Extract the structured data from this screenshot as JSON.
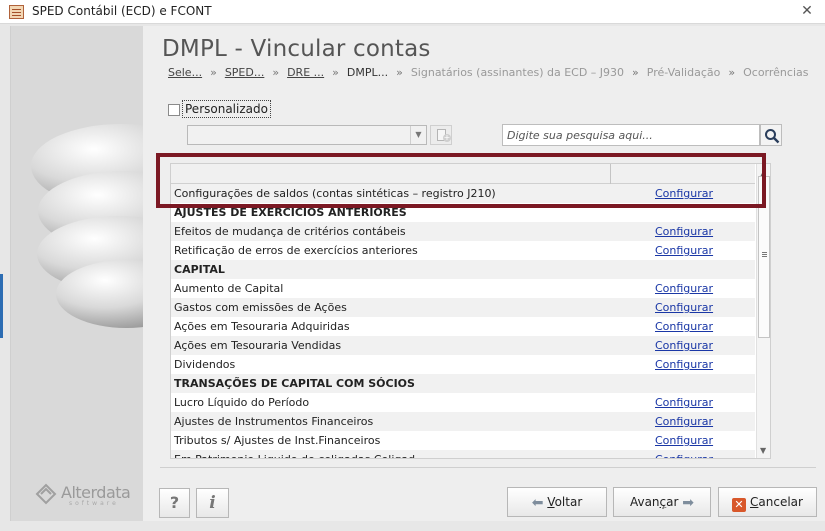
{
  "window": {
    "title": "SPED Contábil (ECD) e FCONT",
    "close_icon": "close-icon"
  },
  "page": {
    "title": "DMPL - Vincular contas"
  },
  "breadcrumb": [
    {
      "label": "Sele...",
      "state": "link"
    },
    {
      "label": "SPED...",
      "state": "link"
    },
    {
      "label": "DRE ...",
      "state": "link"
    },
    {
      "label": "DMPL...",
      "state": "current"
    },
    {
      "label": "Signatários (assinantes) da ECD – J930",
      "state": "muted"
    },
    {
      "label": "Pré-Validação",
      "state": "muted"
    },
    {
      "label": "Ocorrências",
      "state": "muted"
    }
  ],
  "breadcrumb_separator": "»",
  "filter": {
    "personalizado_label": "Personalizado",
    "personalizado_checked": false,
    "combo_value": "",
    "search_placeholder": "Digite sua pesquisa aqui..."
  },
  "grid": {
    "columns": [
      "",
      ""
    ],
    "rows": [
      {
        "label": "Configurações de saldos (contas sintéticas – registro J210)",
        "action": "Configurar",
        "group": false
      },
      {
        "label": "AJUSTES DE EXERCÍCIOS ANTERIORES",
        "action": "",
        "group": true
      },
      {
        "label": "Efeitos de mudança de critérios contábeis",
        "action": "Configurar",
        "group": false
      },
      {
        "label": "Retificação de erros de exercícios anteriores",
        "action": "Configurar",
        "group": false
      },
      {
        "label": "CAPITAL",
        "action": "",
        "group": true
      },
      {
        "label": "Aumento de Capital",
        "action": "Configurar",
        "group": false
      },
      {
        "label": "Gastos com emissões de Ações",
        "action": "Configurar",
        "group": false
      },
      {
        "label": "Ações em Tesouraria Adquiridas",
        "action": "Configurar",
        "group": false
      },
      {
        "label": "Ações em Tesouraria Vendidas",
        "action": "Configurar",
        "group": false
      },
      {
        "label": "Dividendos",
        "action": "Configurar",
        "group": false
      },
      {
        "label": "TRANSAÇÕES DE CAPITAL COM SÓCIOS",
        "action": "",
        "group": true
      },
      {
        "label": "Lucro Líquido do Período",
        "action": "Configurar",
        "group": false
      },
      {
        "label": "Ajustes de Instrumentos Financeiros",
        "action": "Configurar",
        "group": false
      },
      {
        "label": "Tributos s/ Ajustes de Inst.Financeiros",
        "action": "Configurar",
        "group": false
      },
      {
        "label": "Em Patrimonio Liquido de coligadas Coligad...",
        "action": "Configurar",
        "group": false
      }
    ]
  },
  "buttons": {
    "help": "?",
    "info": "i",
    "back_prefix": "",
    "back_underlined": "V",
    "back_rest": "oltar",
    "next_prefix": "Avan",
    "next_underlined": "ç",
    "next_rest": "ar",
    "cancel_prefix": "",
    "cancel_underlined": "C",
    "cancel_rest": "ancelar"
  },
  "logo": {
    "name": "Alterdata",
    "tagline": "software"
  },
  "colors": {
    "highlight_border": "#7b1823",
    "link": "#1a37a6",
    "cancel_icon": "#d8572a"
  }
}
